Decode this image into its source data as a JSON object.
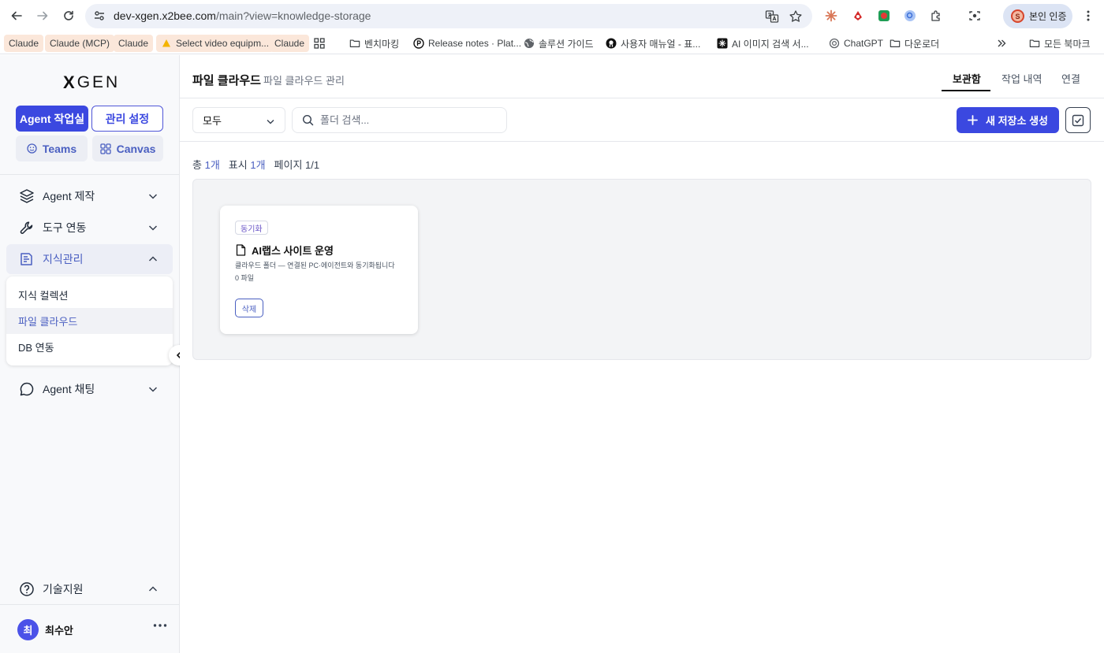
{
  "browser": {
    "url_host": "dev-xgen.x2bee.com",
    "url_path": "/main?view=knowledge-storage",
    "profile_label": "본인 인증",
    "profile_initial": "S"
  },
  "bookmarks": [
    {
      "label": "Claude"
    },
    {
      "label": "Claude (MCP)"
    },
    {
      "label": "Claude"
    },
    {
      "label": "Select video equipm..."
    },
    {
      "label": "Claude"
    },
    {
      "label": "벤치마킹"
    },
    {
      "label": "Release notes · Plat..."
    },
    {
      "label": "솔루션 가이드"
    },
    {
      "label": "사용자 매뉴얼 - 표..."
    },
    {
      "label": "AI 이미지 검색 서..."
    },
    {
      "label": "ChatGPT"
    },
    {
      "label": "다운로더"
    },
    {
      "label": "모든 북마크"
    }
  ],
  "sidebar": {
    "logo_x": "X",
    "logo_rest": "GEN",
    "agent_button": "Agent 작업실",
    "admin_button": "관리 설정",
    "teams_button": "Teams",
    "canvas_button": "Canvas",
    "menu": [
      {
        "label": "Agent 제작"
      },
      {
        "label": "도구 연동"
      },
      {
        "label": "지식관리"
      },
      {
        "label": "Agent 채팅"
      }
    ],
    "submenu": [
      {
        "label": "지식 컬렉션"
      },
      {
        "label": "파일 클라우드"
      },
      {
        "label": "DB 연동"
      }
    ],
    "support": "기술지원",
    "user_initial": "최",
    "user_name": "최수안"
  },
  "header": {
    "title": "파일 클라우드",
    "subtitle": "파일 클라우드 관리",
    "tabs": [
      {
        "label": "보관함"
      },
      {
        "label": "작업 내역"
      },
      {
        "label": "연결"
      }
    ]
  },
  "toolbar": {
    "filter_value": "모두",
    "search_placeholder": "폴더 검색...",
    "new_button": "새 저장소 생성"
  },
  "stats": {
    "total_label": "총",
    "total_value": "1개",
    "shown_label": "표시",
    "shown_value": "1개",
    "page_label": "페이지 1/1"
  },
  "cards": [
    {
      "badge": "동기화",
      "title": "AI랩스 사이트 운영",
      "description": "클라우드 폴더 — 연결된 PC·에이전트와 동기화됩니다",
      "file_count": "0 파일",
      "delete_label": "삭제"
    }
  ],
  "colors": {
    "accent": "#3b48e0",
    "accent_text": "#4a5fc1",
    "badge_text": "#6a55c7"
  }
}
